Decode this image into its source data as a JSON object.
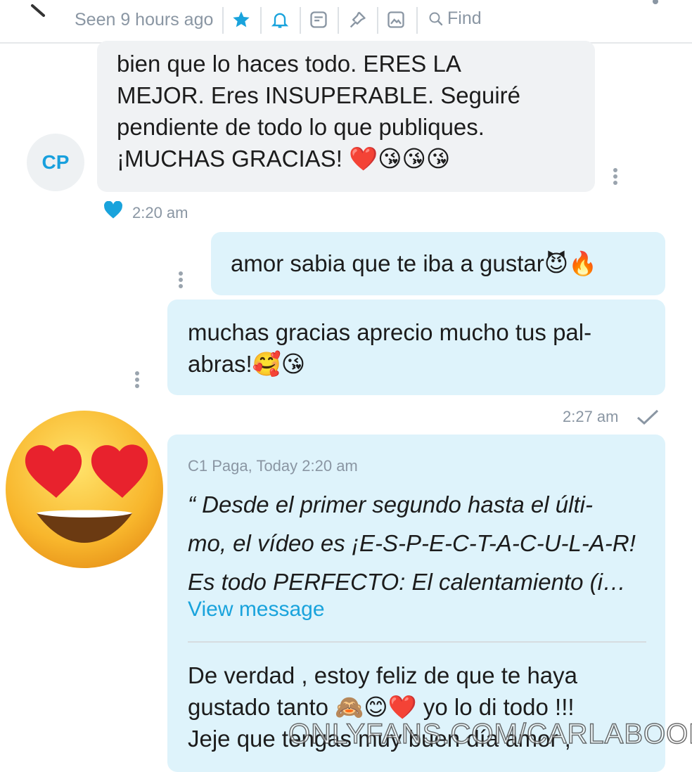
{
  "header": {
    "seen_text": "Seen 9 hours ago",
    "find_label": "Find",
    "icons": [
      "back-arrow-icon",
      "star-icon",
      "bell-icon",
      "note-icon",
      "pin-icon",
      "image-icon",
      "search-icon",
      "more-vertical-icon"
    ]
  },
  "conversation": {
    "incoming": {
      "avatar_initials": "CP",
      "lines": [
        "bien que lo haces todo. ERES LA",
        "MEJOR. Eres INSUPERABLE. Seguiré",
        "pendiente de todo lo que publiques.",
        "¡MUCHAS GRACIAS! ❤️😘😘😘"
      ],
      "time": "2:20 am",
      "liked": true
    },
    "outgoing": [
      {
        "lines": [
          "amor sabia que te iba a gustar😈🔥"
        ]
      },
      {
        "lines": [
          "muchas gracias aprecio mucho tus pal-",
          "abras!🥰😘"
        ]
      }
    ],
    "outgoing_time": "2:27 am",
    "reply": {
      "quote_header": "C1 Paga, Today 2:20 am",
      "quote_lines": [
        "“ Desde el primer segundo hasta el últi-",
        "mo, el vídeo es ¡E-S-P-E-C-T-A-C-U-L-A-R!",
        "Es todo PERFECTO: El calentamiento (i…"
      ],
      "view_message_label": "View message",
      "lines": [
        "De verdad , estoy feliz de que te haya",
        "gustado tanto 🙈😊❤️ yo lo di todo !!!",
        "Jeje que tengas muy buen día amor ,"
      ]
    }
  },
  "overlay": {
    "big_emoji": "😍",
    "watermark": "ONLYFANS.COM/CARLABOOM"
  },
  "colors": {
    "accent": "#19a3dc",
    "outgoing_bubble": "#def3fb",
    "incoming_bubble": "#f0f2f4",
    "muted_text": "#8a96a3"
  }
}
